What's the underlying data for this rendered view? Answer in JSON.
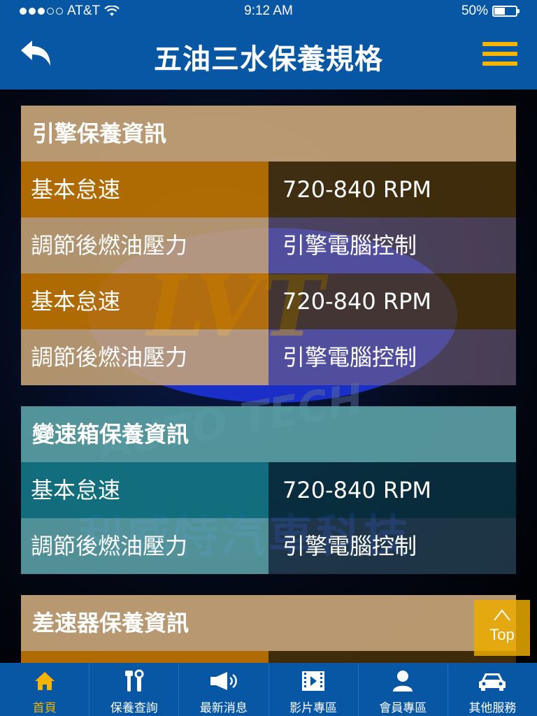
{
  "status_bar": {
    "carrier": "AT&T",
    "time": "9:12 AM",
    "battery": "50%",
    "battery_level": 0.5
  },
  "header": {
    "title": "五油三水保養規格"
  },
  "sections": [
    {
      "title": "引擎保養資訊",
      "rows": [
        {
          "label": "基本怠速",
          "value": "720-840 RPM"
        },
        {
          "label": "調節後燃油壓力",
          "value": "引擎電腦控制"
        },
        {
          "label": "基本怠速",
          "value": "720-840 RPM"
        },
        {
          "label": "調節後燃油壓力",
          "value": "引擎電腦控制"
        }
      ]
    },
    {
      "title": "變速箱保養資訊",
      "rows": [
        {
          "label": "基本怠速",
          "value": "720-840 RPM"
        },
        {
          "label": "調節後燃油壓力",
          "value": "引擎電腦控制"
        }
      ]
    },
    {
      "title": "差速器保養資訊",
      "rows": []
    }
  ],
  "top_button": {
    "label": "Top"
  },
  "tabs": [
    {
      "label": "首頁",
      "icon": "home-icon",
      "active": true
    },
    {
      "label": "保養查詢",
      "icon": "tools-icon",
      "active": false
    },
    {
      "label": "最新消息",
      "icon": "megaphone-icon",
      "active": false
    },
    {
      "label": "影片專區",
      "icon": "video-icon",
      "active": false
    },
    {
      "label": "會員專區",
      "icon": "person-icon",
      "active": false
    },
    {
      "label": "其他服務",
      "icon": "car-icon",
      "active": false
    }
  ],
  "colors": {
    "brand_blue": "#0757a4",
    "accent_yellow": "#f5b400"
  }
}
